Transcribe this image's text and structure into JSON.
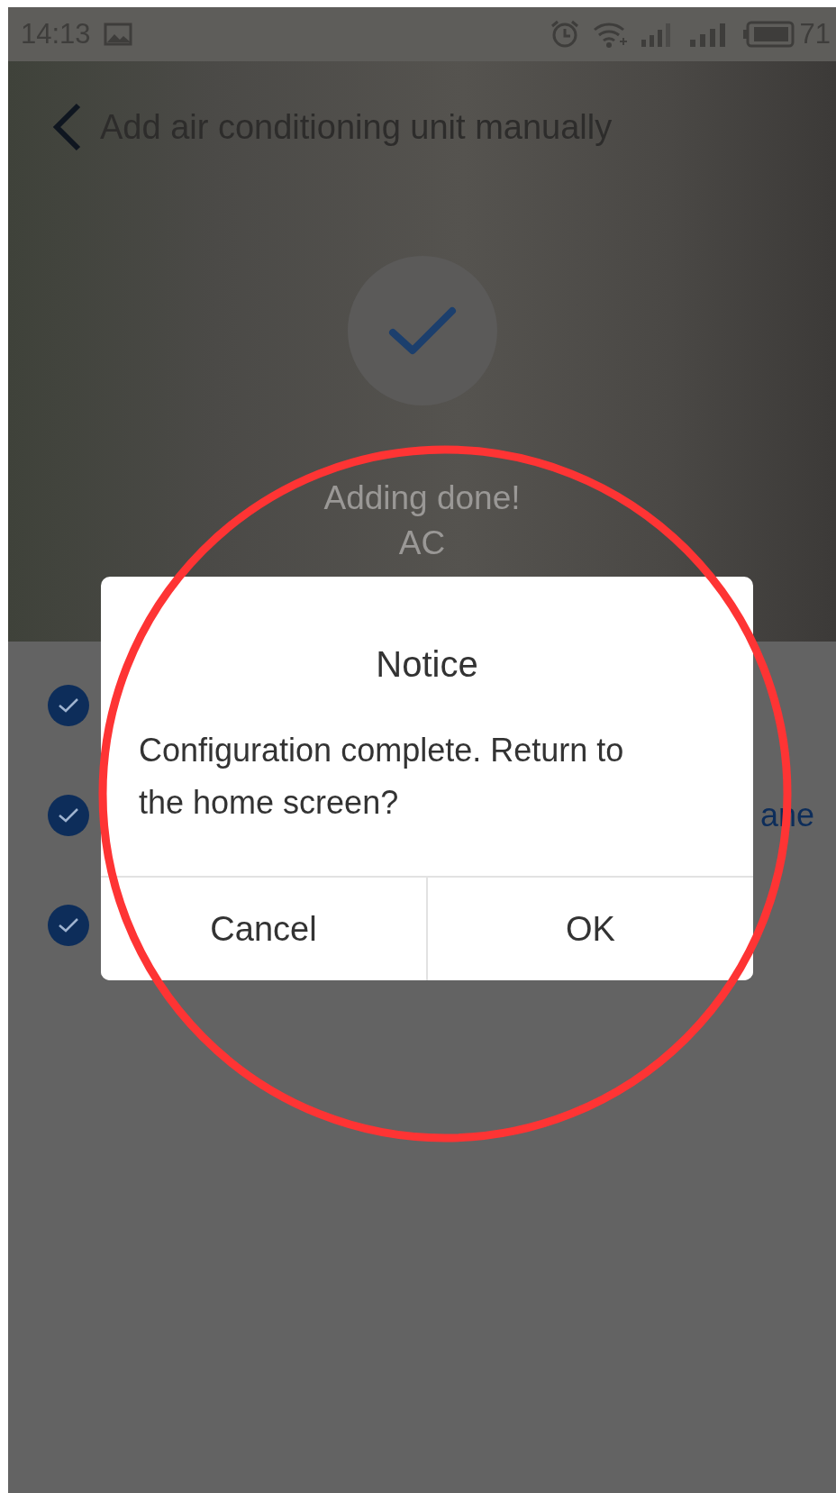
{
  "status_bar": {
    "time": "14:13",
    "battery": "71"
  },
  "header": {
    "title": "Add air conditioning unit manually"
  },
  "result": {
    "message": "Adding done!",
    "device": "AC"
  },
  "steps": [
    {
      "checked": true
    },
    {
      "checked": true,
      "text": "ane"
    },
    {
      "checked": true
    }
  ],
  "dialog": {
    "title": "Notice",
    "message": "Configuration complete. Return to the home screen?",
    "buttons": [
      {
        "label": "Cancel"
      },
      {
        "label": "OK"
      }
    ]
  }
}
